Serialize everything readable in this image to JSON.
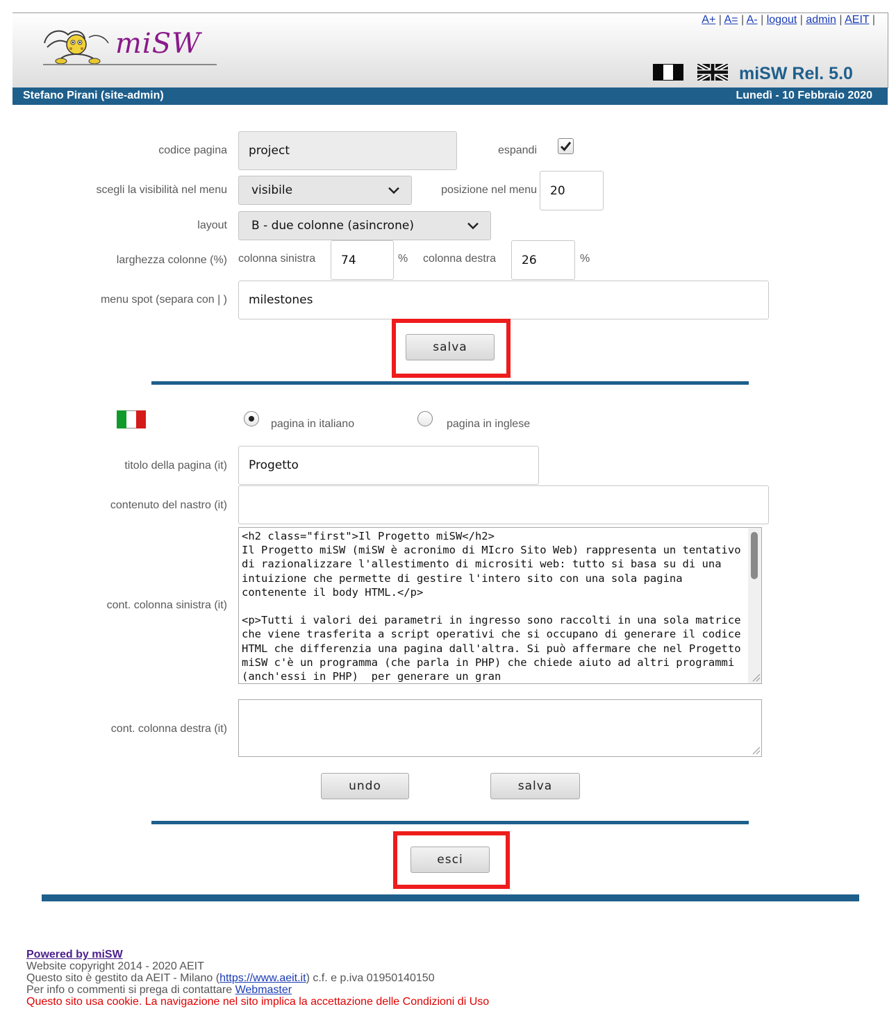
{
  "header": {
    "logo_text": "miSW",
    "links": [
      "A+",
      "A=",
      "A-",
      "logout",
      "admin",
      "AEIT"
    ],
    "release": "miSW Rel. 5.0",
    "user": "Stefano Pirani (site-admin)",
    "date": "Lunedì - 10 Febbraio 2020",
    "accent_color": "#1e5f8c"
  },
  "form": {
    "codice_label": "codice pagina",
    "codice_value": "project",
    "espandi_label": "espandi",
    "espandi_checked": true,
    "visibilita_label": "scegli la visibilità nel menu",
    "visibilita_value": "visibile",
    "posizione_label": "posizione nel menu",
    "posizione_value": "20",
    "layout_label": "layout",
    "layout_value": "B - due colonne (asincrone)",
    "larghezza_label": "larghezza colonne (%)",
    "col_sinistra_label": "colonna sinistra",
    "col_sinistra_value": "74",
    "col_destra_label": "colonna destra",
    "col_destra_value": "26",
    "percent": "%",
    "menu_spot_label": "menu spot (separa con | )",
    "menu_spot_value": "milestones",
    "salva_label": "salva"
  },
  "lang": {
    "radio_it_label": "pagina in italiano",
    "radio_en_label": "pagina in inglese",
    "selected": "it",
    "titolo_label": "titolo della pagina (it)",
    "titolo_value": "Progetto",
    "nastro_label": "contenuto del nastro  (it)",
    "nastro_value": "",
    "col_sin_label": "cont. colonna sinistra (it)",
    "col_sin_value": "<h2 class=\"first\">Il Progetto miSW</h2>\nIl Progetto miSW (miSW è acronimo di MIcro Sito Web) rappresenta un tentativo di razionalizzare l'allestimento di micrositi web: tutto si basa su di una intuizione che permette di gestire l'intero sito con una sola pagina contenente il body HTML.</p>\n\n<p>Tutti i valori dei parametri in ingresso sono raccolti in una sola matrice che viene trasferita a script operativi che si occupano di generare il codice HTML che differenzia una pagina dall'altra. Si può affermare che nel Progetto miSW c'è un programma (che parla in PHP) che chiede aiuto ad altri programmi (anch'essi in PHP)  per generare un gran",
    "col_des_label": "cont. colonna destra (it)",
    "col_des_value": "",
    "undo_label": "undo",
    "salva_label": "salva"
  },
  "esci_label": "esci",
  "footer": {
    "powered": "Powered by miSW",
    "copyright": "Website copyright 2014 - 2020 AEIT",
    "gestito_pre": "Questo sito è gestito da AEIT - Milano (",
    "gestito_link": "https://www.aeit.it",
    "gestito_post": ") c.f. e p.iva 01950140150",
    "info_pre": "Per info o commenti si prega di contattare ",
    "info_link": "Webmaster",
    "cookie": "Questo sito usa cookie. La navigazione nel sito implica la accettazione delle Condizioni di Uso"
  }
}
